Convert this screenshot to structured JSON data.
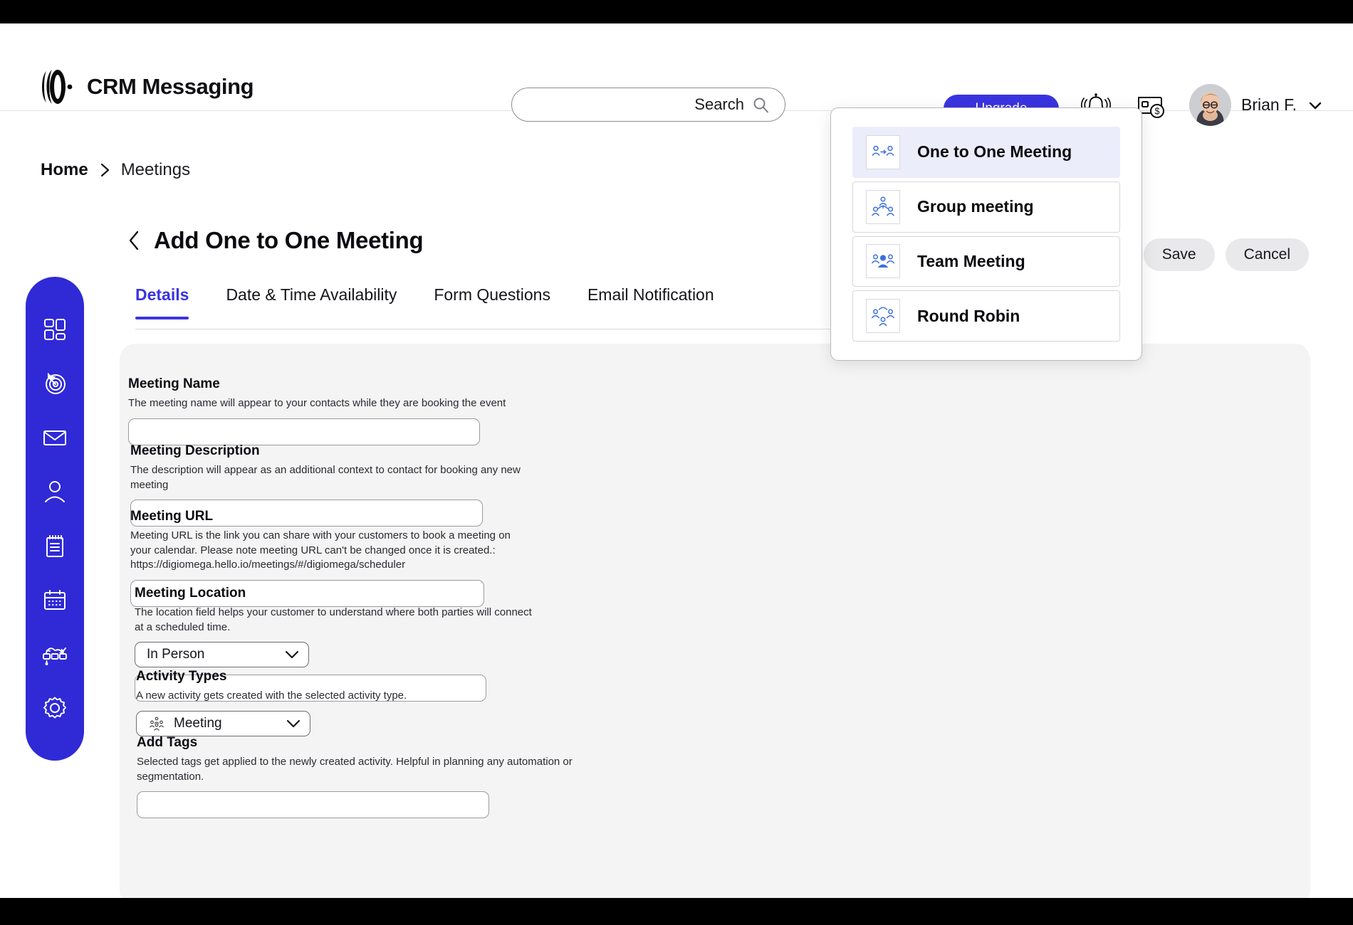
{
  "header": {
    "brand": "CRM Messaging",
    "logo_icon": "soundwave-logo-icon",
    "search": {
      "label": "Search",
      "placeholder": "Search",
      "value": "",
      "icon": "search-icon"
    },
    "upgrade_label": "Upgrade",
    "bell_icon": "notification-bell-icon",
    "wallet_icon": "wallet-billing-icon",
    "user": {
      "name": "Brian F.",
      "chevron_icon": "chevron-down-icon",
      "avatar_icon": "user-avatar"
    }
  },
  "breadcrumb": {
    "home": "Home",
    "separator_icon": "chevron-right-icon",
    "current": "Meetings"
  },
  "page": {
    "back_icon": "chevron-left-icon",
    "title": "Add One to One Meeting",
    "save_label": "Save",
    "cancel_label": "Cancel"
  },
  "tabs": [
    {
      "label": "Details",
      "active": true
    },
    {
      "label": "Date & Time Availability",
      "active": false
    },
    {
      "label": "Form Questions",
      "active": false
    },
    {
      "label": "Email Notification",
      "active": false
    }
  ],
  "form": {
    "meeting_name": {
      "label": "Meeting Name",
      "desc": "The meeting name will appear to your contacts while they are booking the event",
      "value": ""
    },
    "meeting_description": {
      "label": "Meeting Description",
      "desc": "The description will appear as an additional context to contact for booking any new meeting",
      "value": ""
    },
    "meeting_url": {
      "label": "Meeting URL",
      "desc": "Meeting URL is the link you can share with your customers to book a meeting on your calendar. Please note meeting URL can't be changed once it is created.:  https://digiomega.hello.io/meetings/#/digiomega/scheduler",
      "value": ""
    },
    "meeting_location": {
      "label": "Meeting Location",
      "desc": "The location field helps your customer to understand where both parties will connect at a scheduled time.",
      "selected": "In Person",
      "value": ""
    },
    "activity_types": {
      "label": "Activity Types",
      "desc": "A new activity gets created with the selected activity type.",
      "selected": "Meeting",
      "icon": "group-people-icon"
    },
    "add_tags": {
      "label": "Add Tags",
      "desc": "Selected tags get applied to the newly created activity. Helpful in planning any automation or segmentation.",
      "value": ""
    }
  },
  "sidebar": {
    "items": [
      {
        "name": "dashboard",
        "icon": "dashboard-grid-icon"
      },
      {
        "name": "campaigns",
        "icon": "target-icon"
      },
      {
        "name": "messages",
        "icon": "envelope-icon"
      },
      {
        "name": "contacts",
        "icon": "user-icon"
      },
      {
        "name": "notes",
        "icon": "notepad-icon"
      },
      {
        "name": "calendar",
        "icon": "calendar-icon"
      },
      {
        "name": "automation",
        "icon": "workflow-icon"
      },
      {
        "name": "settings",
        "icon": "gear-icon"
      }
    ]
  },
  "meeting_dropdown": {
    "items": [
      {
        "label": "One to One Meeting",
        "icon": "one-to-one-icon",
        "selected": true
      },
      {
        "label": "Group meeting",
        "icon": "group-meeting-icon",
        "selected": false
      },
      {
        "label": "Team Meeting",
        "icon": "team-meeting-icon",
        "selected": false
      },
      {
        "label": "Round Robin",
        "icon": "round-robin-icon",
        "selected": false
      }
    ]
  },
  "colors": {
    "brand_blue": "#3a34e0",
    "sidebar_blue": "#2f2ad6",
    "card_gray": "#f4f4f5",
    "selected_row": "#ecedfb"
  }
}
